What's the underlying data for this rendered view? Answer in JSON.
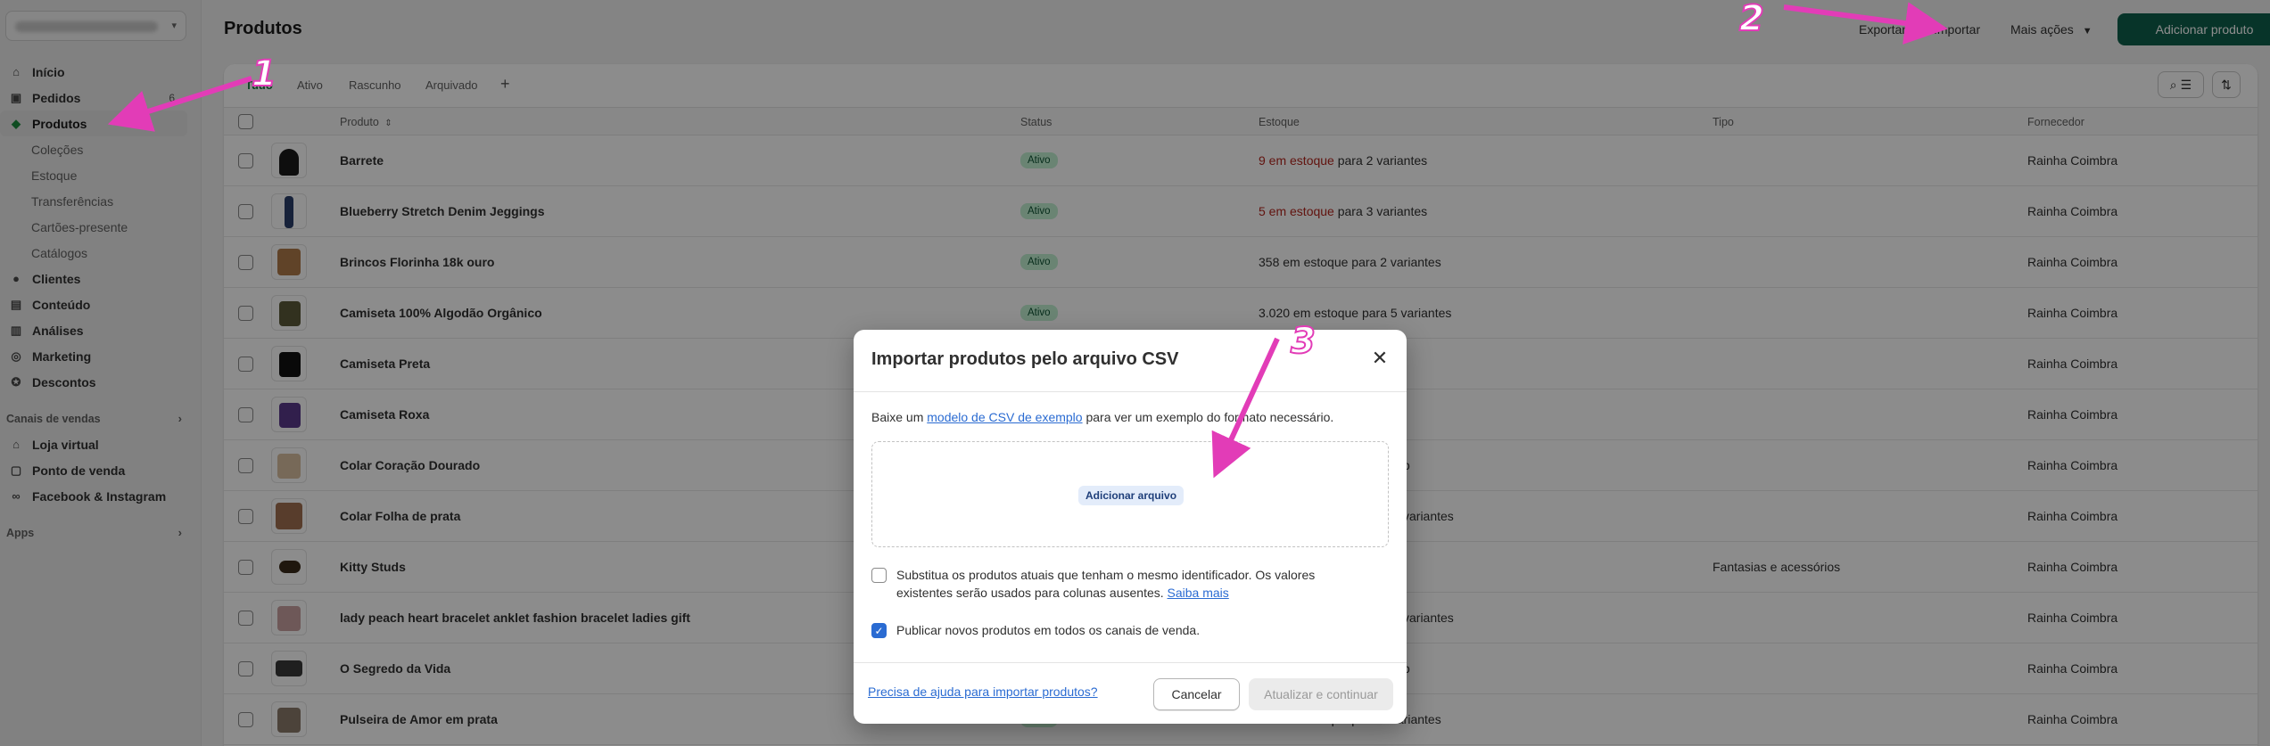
{
  "sidebar": {
    "items": [
      {
        "label": "Início",
        "icon": "home-icon"
      },
      {
        "label": "Pedidos",
        "icon": "orders-icon",
        "count": "6"
      },
      {
        "label": "Produtos",
        "icon": "tag-icon"
      }
    ],
    "sub_items": [
      "Coleções",
      "Estoque",
      "Transferências",
      "Cartões-presente",
      "Catálogos"
    ],
    "items2": [
      {
        "label": "Clientes",
        "icon": "person-icon"
      },
      {
        "label": "Conteúdo",
        "icon": "content-icon"
      },
      {
        "label": "Análises",
        "icon": "chart-icon"
      },
      {
        "label": "Marketing",
        "icon": "target-icon"
      },
      {
        "label": "Descontos",
        "icon": "discount-icon"
      }
    ],
    "sales_channels_label": "Canais de vendas",
    "channels": [
      {
        "label": "Loja virtual",
        "icon": "store-icon"
      },
      {
        "label": "Ponto de venda",
        "icon": "pos-icon"
      },
      {
        "label": "Facebook & Instagram",
        "icon": "meta-icon"
      }
    ],
    "apps_label": "Apps"
  },
  "header": {
    "title": "Produtos",
    "export": "Exportar",
    "import": "Importar",
    "more_actions": "Mais ações",
    "add_product": "Adicionar produto"
  },
  "tabs": [
    "Tudo",
    "Ativo",
    "Rascunho",
    "Arquivado"
  ],
  "table": {
    "columns": [
      "Produto",
      "Status",
      "Estoque",
      "Tipo",
      "Fornecedor"
    ],
    "rows": [
      {
        "name": "Barrete",
        "status": "Ativo",
        "stock_low": "9 em estoque",
        "stock_rest": " para 2 variantes",
        "type": "",
        "vendor": "Rainha Coimbra"
      },
      {
        "name": "Blueberry Stretch Denim Jeggings",
        "status": "Ativo",
        "stock_low": "5 em estoque",
        "stock_rest": " para 3 variantes",
        "type": "",
        "vendor": "Rainha Coimbra"
      },
      {
        "name": "Brincos Florinha 18k ouro",
        "status": "Ativo",
        "stock_low": "",
        "stock_rest": "358 em estoque para 2 variantes",
        "type": "",
        "vendor": "Rainha Coimbra"
      },
      {
        "name": "Camiseta 100% Algodão Orgânico",
        "status": "Ativo",
        "stock_low": "",
        "stock_rest": "3.020 em estoque para 5 variantes",
        "type": "",
        "vendor": "Rainha Coimbra"
      },
      {
        "name": "Camiseta Preta",
        "status": "",
        "stock_low": "",
        "stock_rest": "",
        "type": "",
        "vendor": "Rainha Coimbra"
      },
      {
        "name": "Camiseta Roxa",
        "status": "",
        "stock_low": "",
        "stock_rest": "",
        "type": "",
        "vendor": "Rainha Coimbra"
      },
      {
        "name": "Colar Coração Dourado",
        "status": "",
        "stock_low": "",
        "stock_rest": "o",
        "type": "",
        "vendor": "Rainha Coimbra"
      },
      {
        "name": "Colar Folha de prata",
        "status": "",
        "stock_low": "",
        "stock_rest": "variantes",
        "type": "",
        "vendor": "Rainha Coimbra"
      },
      {
        "name": "Kitty Studs",
        "status": "",
        "stock_low": "",
        "stock_rest": "",
        "type": "Fantasias e acessórios",
        "vendor": "Rainha Coimbra"
      },
      {
        "name": "lady peach heart bracelet anklet fashion bracelet ladies gift",
        "status": "",
        "stock_low": "",
        "stock_rest": "variantes",
        "type": "",
        "vendor": "Rainha Coimbra"
      },
      {
        "name": "O Segredo da Vida",
        "status": "",
        "stock_low": "",
        "stock_rest": "o",
        "type": "",
        "vendor": "Rainha Coimbra"
      },
      {
        "name": "Pulseira de Amor em prata",
        "status": "Ativo",
        "stock_low": "",
        "stock_rest": "379 em estoque para 2 variantes",
        "type": "",
        "vendor": "Rainha Coimbra"
      }
    ]
  },
  "modal": {
    "title": "Importar produtos pelo arquivo CSV",
    "intro_pre": "Baixe um ",
    "intro_link": "modelo de CSV de exemplo",
    "intro_post": " para ver um exemplo do formato necessário.",
    "add_file": "Adicionar arquivo",
    "option1": "Substitua os produtos atuais que tenham o mesmo identificador. Os valores existentes serão usados para colunas ausentes. ",
    "option1_link": "Saiba mais",
    "option2": "Publicar novos produtos em todos os canais de venda.",
    "help_link": "Precisa de ajuda para importar produtos?",
    "cancel": "Cancelar",
    "submit": "Atualizar e continuar"
  },
  "annotations": [
    "1",
    "2",
    "3"
  ],
  "colors": {
    "accent": "#0d5f4b",
    "annotation": "#e23cb7",
    "link": "#2a6bd2",
    "badge_bg": "#c2f0d2",
    "low_stock": "#b3261e"
  }
}
